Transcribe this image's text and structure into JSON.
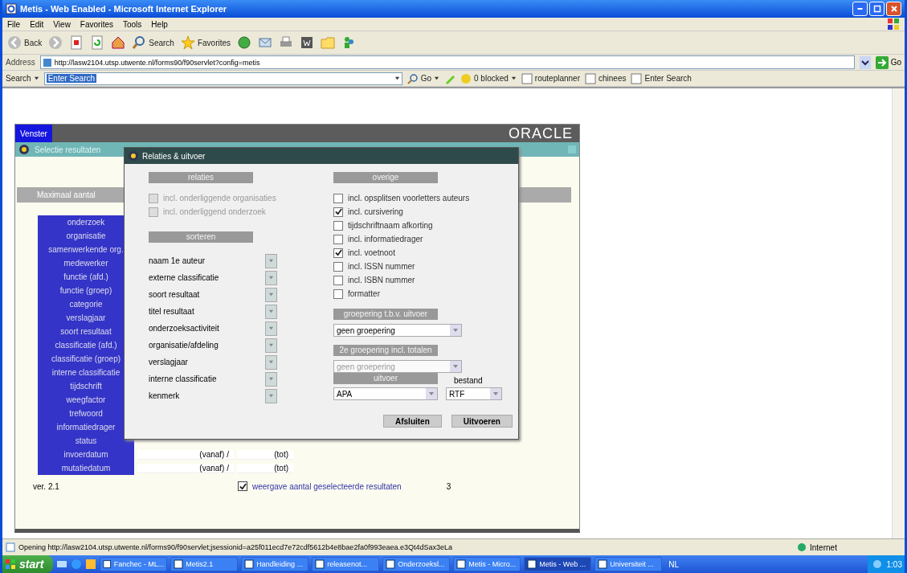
{
  "window": {
    "title": "Metis - Web Enabled - Microsoft Internet Explorer"
  },
  "menu": [
    "File",
    "Edit",
    "View",
    "Favorites",
    "Tools",
    "Help"
  ],
  "toolbar": {
    "back": "Back",
    "search": "Search",
    "favorites": "Favorites"
  },
  "address": {
    "label": "Address",
    "url": "http://lasw2104.utsp.utwente.nl/forms90/f90servlet?config=metis",
    "go": "Go"
  },
  "search_bar": {
    "label": "Search",
    "value": "Enter Search",
    "go": "Go",
    "blocked": "0 blocked",
    "links": [
      "routeplanner",
      "chinees",
      "Enter Search"
    ]
  },
  "app": {
    "menu_button": "Venster",
    "logo": "ORACLE",
    "subtitle": "Selectie resultaten",
    "section_bar": "Maximaal aantal",
    "criteria": [
      {
        "label": "onderzoek"
      },
      {
        "label": "organisatie"
      },
      {
        "label": "samenwerkende org."
      },
      {
        "label": "medewerker"
      },
      {
        "label": "functie (afd.)"
      },
      {
        "label": "functie (groep)"
      },
      {
        "label": "categorie"
      },
      {
        "label": "verslagjaar"
      },
      {
        "label": "soort resultaat"
      },
      {
        "label": "classificatie (afd.)"
      },
      {
        "label": "classificatie (groep)"
      },
      {
        "label": "interne classificatie"
      },
      {
        "label": "tijdschrift"
      },
      {
        "label": "weegfactor"
      },
      {
        "label": "trefwoord"
      },
      {
        "label": "informatiedrager"
      },
      {
        "label": "status"
      },
      {
        "label": "invoerdatum",
        "from": "(vanaf) /",
        "to": "(tot)"
      },
      {
        "label": "mutatiedatum",
        "from": "(vanaf) /",
        "to": "(tot)"
      }
    ],
    "version": "ver. 2.1",
    "count": {
      "label": "weergave aantal geselecteerde resultaten",
      "checked": true,
      "value": "3"
    }
  },
  "dialog": {
    "title": "Relaties & uitvoer",
    "relations": {
      "heading": "relaties",
      "options": [
        {
          "label": "incl. onderliggende organisaties",
          "checked": false,
          "disabled": true
        },
        {
          "label": "incl. onderliggend onderzoek",
          "checked": false,
          "disabled": true
        }
      ]
    },
    "sort": {
      "heading": "sorteren",
      "fields": [
        "naam 1e auteur",
        "externe classificatie",
        "soort resultaat",
        "titel resultaat",
        "onderzoeksactiviteit",
        "organisatie/afdeling",
        "verslagjaar",
        "interne classificatie",
        "kenmerk"
      ]
    },
    "other": {
      "heading": "overige",
      "options": [
        {
          "label": "incl. opsplitsen voorletters auteurs",
          "checked": false
        },
        {
          "label": "incl. cursivering",
          "checked": true
        },
        {
          "label": "tijdschriftnaam afkorting",
          "checked": false
        },
        {
          "label": "incl. informatiedrager",
          "checked": false
        },
        {
          "label": "incl. voetnoot",
          "checked": true
        },
        {
          "label": "incl. ISSN nummer",
          "checked": false
        },
        {
          "label": "incl. ISBN nummer",
          "checked": false
        },
        {
          "label": "formatter",
          "checked": false
        }
      ]
    },
    "groupings": [
      {
        "heading": "groepering t.b.v. uitvoer",
        "value": "geen groepering",
        "disabled": false
      },
      {
        "heading": "2e groepering incl. totalen",
        "value": "geen groepering",
        "disabled": true
      }
    ],
    "output": {
      "heading": "uitvoer",
      "value": "APA",
      "file_label": "bestand",
      "file_value": "RTF"
    },
    "buttons": [
      "Afsluiten",
      "Uitvoeren"
    ]
  },
  "status_bar": {
    "text": "Opening http://lasw2104.utsp.utwente.nl/forms90/f90servlet;jsessionid=a25f011ecd7e72cdf5612b4e8bae2fa0f993eaea.e3Qt4dSax3eLa",
    "zone": "Internet"
  },
  "taskbar": {
    "start": "start",
    "tasks": [
      {
        "label": "Fanchec - ML...",
        "selected": false
      },
      {
        "label": "Metis2.1",
        "selected": false
      },
      {
        "label": "Handleiding ...",
        "selected": false
      },
      {
        "label": "releasenot...",
        "selected": false
      },
      {
        "label": "Onderzoeksl...",
        "selected": false
      },
      {
        "label": "Metis - Micro...",
        "selected": false
      },
      {
        "label": "Metis - Web ...",
        "selected": true
      },
      {
        "label": "Universiteit ...",
        "selected": false
      }
    ],
    "language": "NL",
    "clock": "1:03"
  }
}
